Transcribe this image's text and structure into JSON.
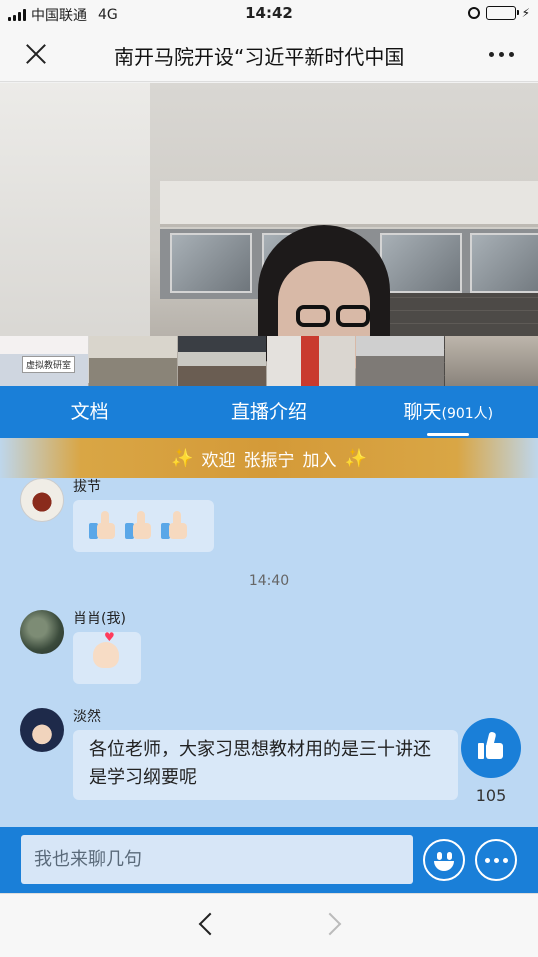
{
  "status_bar": {
    "carrier": "中国联通",
    "network": "4G",
    "time": "14:42",
    "battery_level": 0.8,
    "icons": [
      "signal-icon",
      "alarm-icon",
      "battery-icon",
      "charging-icon"
    ]
  },
  "header": {
    "title": "南开马院开设“习近平新时代中国",
    "close_icon": "close-icon",
    "more_icon": "more-icon"
  },
  "video": {
    "thumbnail_label": "虚拟教研室",
    "thumbnail_count": 6
  },
  "tabs": [
    {
      "label": "文档"
    },
    {
      "label": "直播介绍"
    },
    {
      "label": "聊天",
      "count": "(901人)",
      "active": true
    }
  ],
  "chat": {
    "welcome": {
      "prefix": "欢迎",
      "name": "张振宁",
      "suffix": "加入"
    },
    "messages": [
      {
        "nickname": "拔节",
        "content": "👍👍👍",
        "emoji": "thumbs-up-icon"
      },
      {
        "time_separator": "14:40"
      },
      {
        "nickname": "肖肖(我)",
        "content": "🫰",
        "emoji": "finger-heart-icon"
      },
      {
        "nickname": "淡然",
        "content": "各位老师，大家习思想教材用的是三十讲还是学习纲要呢"
      }
    ],
    "like_count": "105"
  },
  "input": {
    "placeholder": "我也来聊几句"
  },
  "colors": {
    "primary": "#1a7fd8",
    "chat_background": "#bcd8f3",
    "welcome_banner": "#d49a38"
  }
}
